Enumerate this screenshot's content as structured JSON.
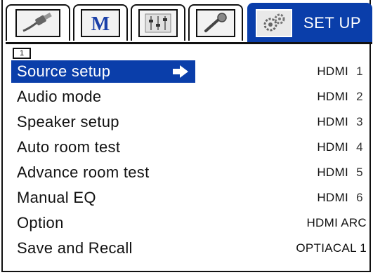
{
  "tabs": [
    {
      "id": "tab-input",
      "icon": "cable-plug-icon"
    },
    {
      "id": "tab-mode",
      "icon": "m-letter-icon"
    },
    {
      "id": "tab-mixer",
      "icon": "mixer-sliders-icon"
    },
    {
      "id": "tab-mic",
      "icon": "microphone-icon"
    },
    {
      "id": "tab-setup",
      "icon": "gears-icon",
      "label": "SET UP",
      "active": true
    }
  ],
  "page_indicator": "1",
  "menu": {
    "items": [
      {
        "label": "Source setup",
        "value": "HDMI",
        "num": "1",
        "selected": true
      },
      {
        "label": "Audio mode",
        "value": "HDMI",
        "num": "2"
      },
      {
        "label": "Speaker setup",
        "value": "HDMI",
        "num": "3"
      },
      {
        "label": "Auto room test",
        "value": "HDMI",
        "num": "4"
      },
      {
        "label": "Advance room test",
        "value": "HDMI",
        "num": "5"
      },
      {
        "label": "Manual EQ",
        "value": "HDMI",
        "num": "6"
      },
      {
        "label": "Option",
        "value": "HDMI ARC",
        "num": ""
      },
      {
        "label": "Save and Recall",
        "value": "OPTIACAL 1",
        "num": ""
      }
    ]
  },
  "colors": {
    "accent": "#0a3eaa",
    "text": "#111111",
    "background": "#ffffff"
  }
}
